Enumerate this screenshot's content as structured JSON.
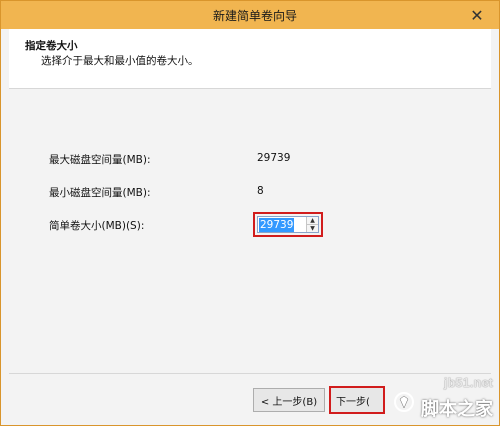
{
  "window": {
    "title": "新建简单卷向导",
    "close_glyph": "✕"
  },
  "header": {
    "title": "指定卷大小",
    "subtitle": "选择介于最大和最小值的卷大小。"
  },
  "fields": {
    "max_label": "最大磁盘空间量(MB):",
    "max_value": "29739",
    "min_label": "最小磁盘空间量(MB):",
    "min_value": "8",
    "size_label": "简单卷大小(MB)(S):",
    "size_value": "29739"
  },
  "buttons": {
    "back_label": "< 上一步(B)",
    "next_label": "下一步("
  },
  "watermark": {
    "url": "jb51.net",
    "name": "脚本之家"
  },
  "colors": {
    "titlebar": "#f1b550",
    "highlight_border": "#d11c1c",
    "selection": "#3399ff"
  }
}
